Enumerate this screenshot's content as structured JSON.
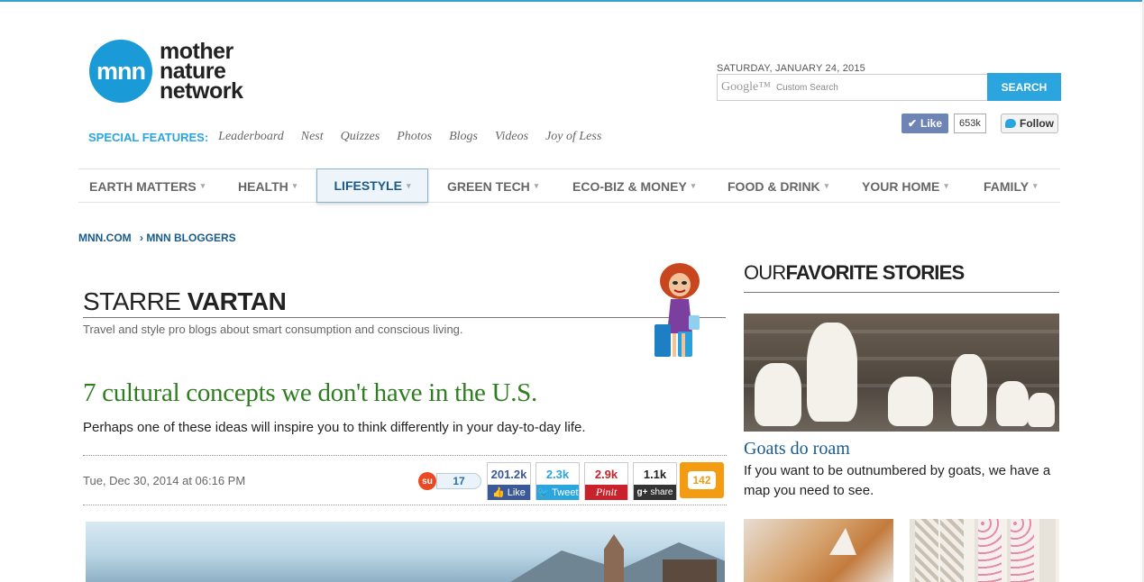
{
  "header": {
    "logo_mark": "mnn",
    "logo_lines": [
      "mother",
      "nature",
      "network"
    ],
    "date": "SATURDAY, JANUARY 24, 2015",
    "search_brand": "Google™",
    "search_placeholder": "Custom Search",
    "search_button": "SEARCH",
    "fb_like": "Like",
    "fb_count": "653k",
    "twitter_follow": "Follow"
  },
  "special_features": {
    "label": "SPECIAL FEATURES:",
    "links": [
      "Leaderboard",
      "Nest",
      "Quizzes",
      "Photos",
      "Blogs",
      "Videos",
      "Joy of Less"
    ]
  },
  "nav": {
    "items": [
      {
        "label": "EARTH MATTERS"
      },
      {
        "label": "HEALTH"
      },
      {
        "label": "LIFESTYLE"
      },
      {
        "label": "GREEN TECH"
      },
      {
        "label": "ECO-BIZ & MONEY"
      },
      {
        "label": "FOOD & DRINK"
      },
      {
        "label": "YOUR HOME"
      },
      {
        "label": "FAMILY"
      }
    ],
    "active": "LIFESTYLE",
    "caret": "▾"
  },
  "breadcrumb": [
    "MNN.COM",
    "› MNN BLOGGERS"
  ],
  "blogger": {
    "first_name": "STARRE",
    "last_name": "VARTAN",
    "description": "Travel and style pro blogs about smart consumption and conscious living."
  },
  "article": {
    "title": "7 cultural concepts we don't have in the U.S.",
    "dek": "Perhaps one of these ideas will inspire you to think differently in your day-to-day life.",
    "date": "Tue, Dec 30, 2014 at 06:16 PM"
  },
  "share": {
    "stumbleupon_count": "17",
    "facebook_count": "201.2k",
    "facebook_label": "Like",
    "twitter_count": "2.3k",
    "twitter_label": "Tweet",
    "pinterest_count": "2.9k",
    "pinterest_label": "Pinit",
    "googleplus_count": "1.1k",
    "googleplus_label": "share",
    "comments_count": "142"
  },
  "sidebar": {
    "title_light": "OUR",
    "title_bold": "FAVORITE STORIES",
    "story_title": "Goats do roam",
    "story_desc": "If you want to be outnumbered by goats, we have a map you need to see."
  },
  "colors": {
    "brand_blue": "#1a9ad7",
    "link_blue": "#1a5b8a",
    "headline_green": "#2e7d1f",
    "search_blue": "#2ba5de"
  }
}
